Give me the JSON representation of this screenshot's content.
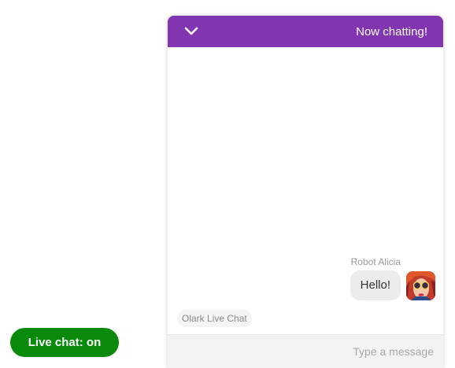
{
  "chat_window": {
    "header_title": "Now chatting!",
    "collapse_icon": "chevron-down-icon",
    "accent_color": "#8135b0",
    "message": {
      "author": "Robot Alicia",
      "text": "Hello!"
    },
    "branding": "Olark Live Chat",
    "input": {
      "placeholder": "Type a message",
      "value": ""
    }
  },
  "live_chat_button": {
    "label": "Live chat: on",
    "color": "#0a8a0a"
  }
}
